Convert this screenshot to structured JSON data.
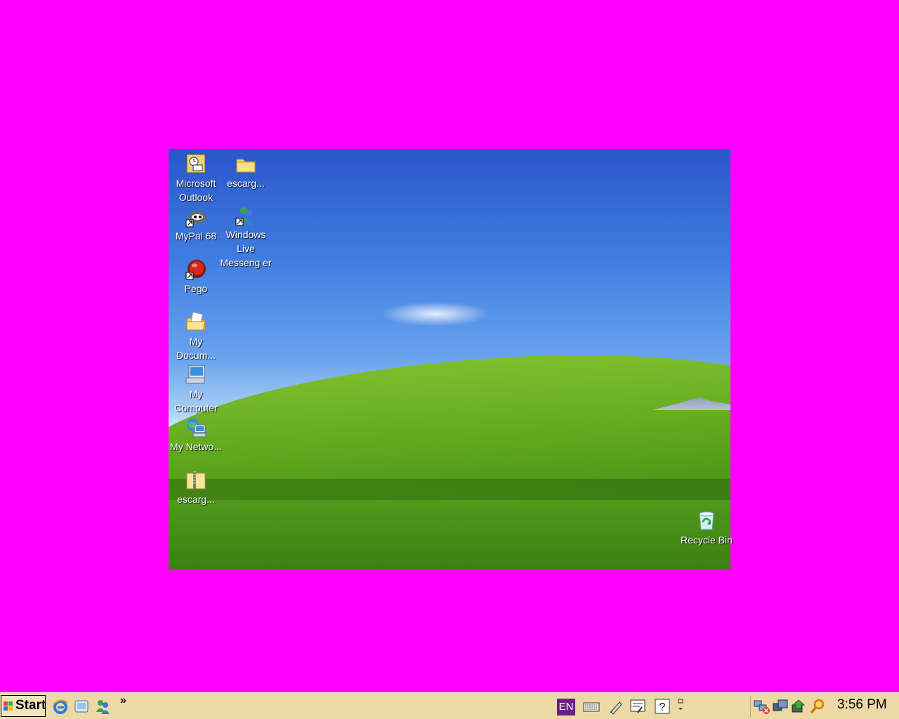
{
  "desktop": {
    "icons": [
      {
        "label": "Microsoft Outlook",
        "icon": "outlook-icon"
      },
      {
        "label": "escarg...",
        "icon": "folder-icon"
      },
      {
        "label": "MyPal 68",
        "icon": "mypal-icon"
      },
      {
        "label": "Windows Live Messeng er",
        "icon": "messenger-icon"
      },
      {
        "label": "Pego",
        "icon": "pego-icon"
      },
      {
        "label": "My Docum...",
        "icon": "my-documents-icon"
      },
      {
        "label": "My Computer",
        "icon": "my-computer-icon"
      },
      {
        "label": "My Netwo...",
        "icon": "my-network-icon"
      },
      {
        "label": "escarg...",
        "icon": "zip-folder-icon"
      },
      {
        "label": "Recycle Bin",
        "icon": "recycle-bin-icon"
      }
    ]
  },
  "taskbar": {
    "start_label": "Start",
    "quick_launch": [
      "internet-explorer-icon",
      "show-desktop-icon",
      "messenger-icon"
    ],
    "chevron": "»",
    "language": "EN",
    "clock": "3:56 PM"
  },
  "colors": {
    "background": "#ff00ff",
    "taskbar": "#ecd9a6",
    "language_badge": "#6b1f87"
  }
}
